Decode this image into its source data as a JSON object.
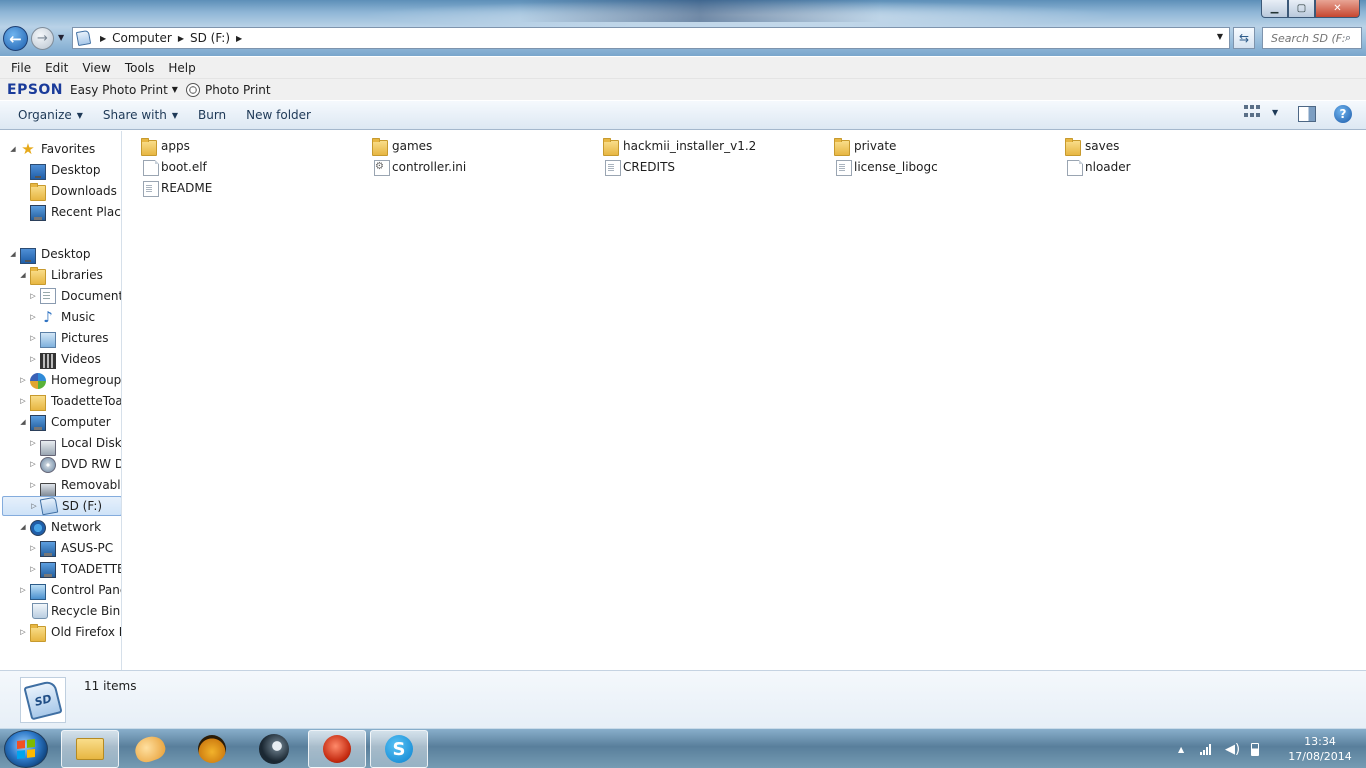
{
  "window": {
    "controls": {
      "minimize": "▁",
      "maximize": "▢",
      "close": "✕"
    }
  },
  "address": {
    "crumbs": [
      "Computer",
      "SD (F:)"
    ],
    "search_placeholder": "Search SD (F:)"
  },
  "menu": [
    "File",
    "Edit",
    "View",
    "Tools",
    "Help"
  ],
  "epson": {
    "logo": "EPSON",
    "easy_photo_print": "Easy Photo Print",
    "photo_print": "Photo Print"
  },
  "commands": {
    "organize": "Organize",
    "share_with": "Share with",
    "burn": "Burn",
    "new_folder": "New folder"
  },
  "nav": {
    "favorites": "Favorites",
    "fav_desktop": "Desktop",
    "downloads": "Downloads",
    "recent_places": "Recent Places",
    "desktop": "Desktop",
    "libraries": "Libraries",
    "documents": "Documents",
    "music": "Music",
    "pictures": "Pictures",
    "videos": "Videos",
    "homegroup": "Homegroup",
    "user": "ToadetteToad",
    "computer": "Computer",
    "local_disk": "Local Disk (C:)",
    "dvd": "DVD RW Drive",
    "removable": "Removable Disk",
    "sd": "SD (F:)",
    "network": "Network",
    "asus_pc": "ASUS-PC",
    "toadette": "TOADETTE",
    "control_panel": "Control Panel",
    "recycle_bin": "Recycle Bin",
    "old_firefox": "Old Firefox Data"
  },
  "files": {
    "apps": "apps",
    "games": "games",
    "hackmii": "hackmii_installer_v1.2",
    "private": "private",
    "saves": "saves",
    "boot_elf": "boot.elf",
    "controller_ini": "controller.ini",
    "credits": "CREDITS",
    "license_libogc": "license_libogc",
    "nloader": "nloader",
    "readme": "README"
  },
  "details": {
    "sd_icon_text": "SD",
    "item_count": "11 items"
  },
  "taskbar": {
    "skype_glyph": "S",
    "time": "13:34",
    "date": "17/08/2014"
  },
  "colors": {
    "accent": "#1e3957",
    "selection": "#cfe3f8",
    "epson_blue": "#1a3b9a"
  }
}
